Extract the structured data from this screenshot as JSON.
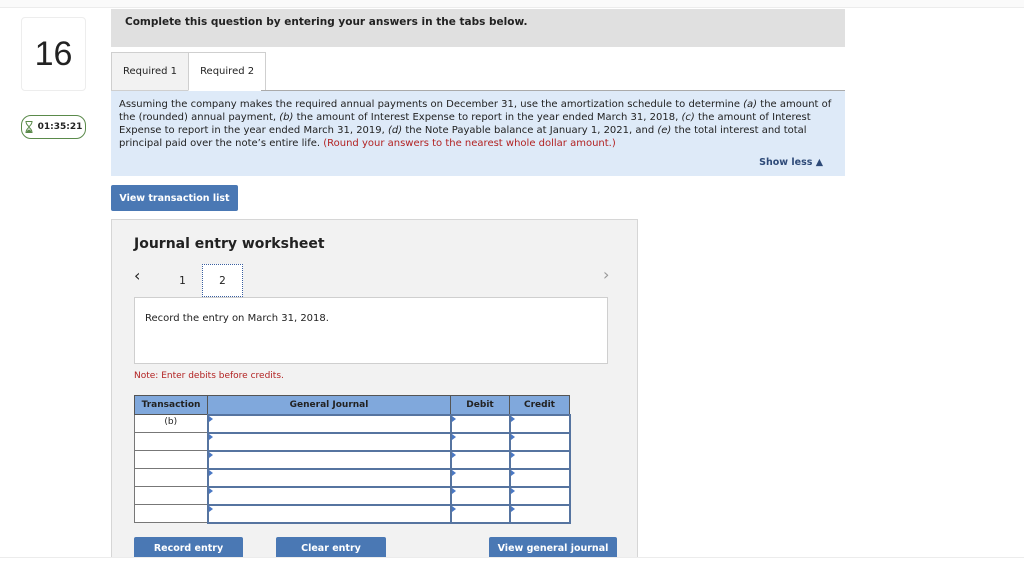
{
  "question": {
    "number": "16",
    "timer": "01:35:21"
  },
  "instructions": "Complete this question by entering your answers in the tabs below.",
  "tabs": [
    {
      "label": "Required 1",
      "active": false
    },
    {
      "label": "Required 2",
      "active": true
    }
  ],
  "prompt": {
    "seg1": "Assuming the company makes the required annual payments on December 31, use the amortization schedule to determine ",
    "a": "(a)",
    "seg2": " the amount of the (rounded) annual payment, ",
    "b": "(b)",
    "seg3": " the amount of Interest Expense to report in the year ended March 31, 2018, ",
    "c": "(c)",
    "seg4": " the amount of Interest Expense to report in the year ended March 31, 2019, ",
    "d": "(d)",
    "seg5": " the Note Payable balance at January 1, 2021, and ",
    "e": "(e)",
    "seg6": " the total interest and total principal paid over the note’s entire life. ",
    "rounding": "(Round your answers to the nearest whole dollar amount.)",
    "show_less": "Show less ▲"
  },
  "buttons": {
    "view_transaction_list": "View transaction list",
    "record_entry": "Record entry",
    "clear_entry": "Clear entry",
    "view_general_journal": "View general journal"
  },
  "worksheet": {
    "title": "Journal entry worksheet",
    "prev_icon": "‹",
    "next_icon": "›",
    "pages": [
      "1",
      "2"
    ],
    "current_page": "2",
    "entry_instruction": "Record the entry on March 31, 2018.",
    "note": "Note: Enter debits before credits."
  },
  "journal": {
    "headers": {
      "transaction": "Transaction",
      "general_journal": "General Journal",
      "debit": "Debit",
      "credit": "Credit"
    },
    "rows": [
      {
        "transaction": "(b)",
        "account": "",
        "debit": "",
        "credit": ""
      },
      {
        "transaction": "",
        "account": "",
        "debit": "",
        "credit": ""
      },
      {
        "transaction": "",
        "account": "",
        "debit": "",
        "credit": ""
      },
      {
        "transaction": "",
        "account": "",
        "debit": "",
        "credit": ""
      },
      {
        "transaction": "",
        "account": "",
        "debit": "",
        "credit": ""
      },
      {
        "transaction": "",
        "account": "",
        "debit": "",
        "credit": ""
      }
    ]
  },
  "colors": {
    "button_blue": "#4a78b4",
    "header_blue": "#80a8dc",
    "prompt_bg": "#deeaf8",
    "note_red": "#b22222",
    "timer_green": "#5a8a4a"
  }
}
